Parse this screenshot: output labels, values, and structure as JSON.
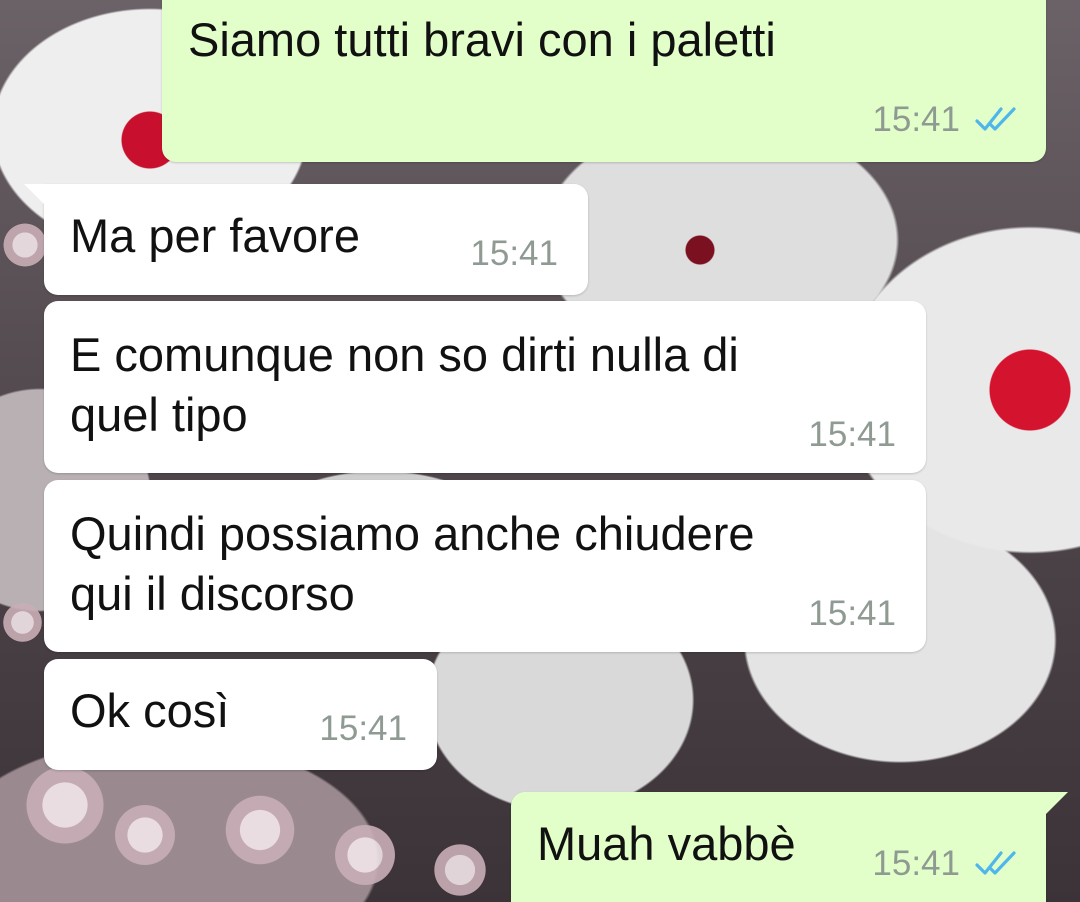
{
  "chat": {
    "messages": [
      {
        "id": "m1",
        "direction": "outgoing",
        "lines": [
          "Siamo tutti bravi con i paletti"
        ],
        "time": "15:41",
        "status_icon": "double-check-icon",
        "status_color": "#4fb6ec"
      },
      {
        "id": "m2",
        "direction": "incoming",
        "lines": [
          "Ma per favore"
        ],
        "time": "15:41"
      },
      {
        "id": "m3",
        "direction": "incoming",
        "lines": [
          "E comunque non so dirti nulla di",
          "quel tipo"
        ],
        "time": "15:41"
      },
      {
        "id": "m4",
        "direction": "incoming",
        "lines": [
          "Quindi possiamo anche chiudere",
          "qui il discorso"
        ],
        "time": "15:41"
      },
      {
        "id": "m5",
        "direction": "incoming",
        "lines": [
          "Ok così"
        ],
        "time": "15:41"
      },
      {
        "id": "m6",
        "direction": "outgoing",
        "lines": [
          "Muah vabbè"
        ],
        "time": "15:41",
        "status_icon": "double-check-icon",
        "status_color": "#4fb6ec"
      }
    ]
  },
  "colors": {
    "incoming_bubble": "#ffffff",
    "outgoing_bubble": "#e2ffc9",
    "timestamp": "#8f9a92",
    "read_ticks": "#4fb6ec"
  }
}
